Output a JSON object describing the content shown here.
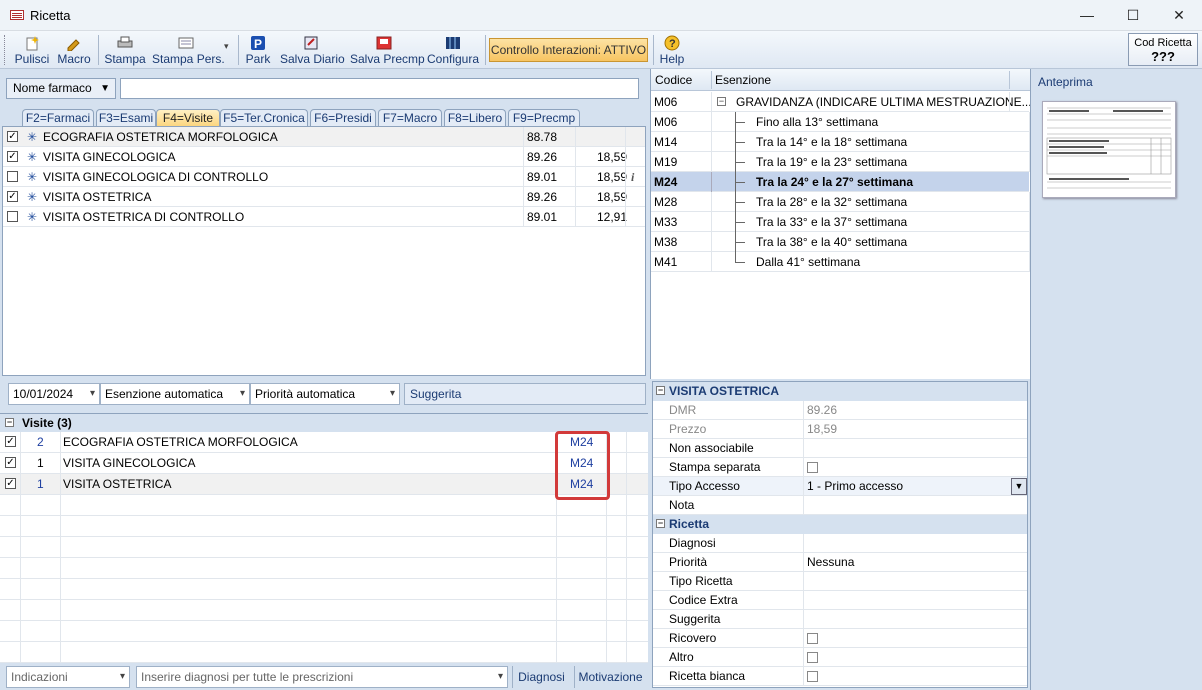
{
  "window": {
    "title": "Ricetta",
    "minimize": "—",
    "maximize": "☐",
    "close": "✕"
  },
  "toolbar": {
    "pulisci": "Pulisci",
    "macro": "Macro",
    "stampa": "Stampa",
    "stampa_pers": "Stampa Pers.",
    "park": "Park",
    "salva_diario": "Salva Diario",
    "salva_precmp": "Salva Precmp",
    "configura": "Configura",
    "controllo": "Controllo Interazioni: ATTIVO",
    "help": "Help",
    "cod_ricetta_label": "Cod Ricetta",
    "cod_ricetta_value": "???"
  },
  "search": {
    "mode": "Nome farmaco",
    "value": ""
  },
  "tabs": [
    "F2=Farmaci",
    "F3=Esami",
    "F4=Visite",
    "F5=Ter.Cronica",
    "F6=Presidi",
    "F7=Macro",
    "F8=Libero",
    "F9=Precmp"
  ],
  "active_tab": "F4=Visite",
  "catalog": [
    {
      "checked": true,
      "name": "ECOGRAFIA OSTETRICA MORFOLOGICA",
      "code": "88.78",
      "price": ""
    },
    {
      "checked": true,
      "name": "VISITA GINECOLOGICA",
      "code": "89.26",
      "price": "18,59"
    },
    {
      "checked": false,
      "name": "VISITA GINECOLOGICA DI CONTROLLO",
      "code": "89.01",
      "price": "18,59",
      "info": "i"
    },
    {
      "checked": true,
      "name": "VISITA OSTETRICA",
      "code": "89.26",
      "price": "18,59"
    },
    {
      "checked": false,
      "name": "VISITA OSTETRICA DI CONTROLLO",
      "code": "89.01",
      "price": "12,91"
    }
  ],
  "filters": {
    "date": "10/01/2024",
    "esenzione": "Esenzione automatica",
    "priorita": "Priorità automatica",
    "suggerita": "Suggerita"
  },
  "visits": {
    "header": "Visite (3)",
    "rows": [
      {
        "qty": "2",
        "name": "ECOGRAFIA OSTETRICA MORFOLOGICA",
        "code": "M24"
      },
      {
        "qty": "1",
        "name": "VISITA GINECOLOGICA",
        "code": "M24"
      },
      {
        "qty": "1",
        "name": "VISITA OSTETRICA",
        "code": "M24"
      }
    ]
  },
  "bottom": {
    "indicazioni": "Indicazioni",
    "diagnosi_placeholder": "Inserire diagnosi per tutte le prescrizioni",
    "diagnosi": "Diagnosi",
    "motivazione": "Motivazione"
  },
  "esenzioni": {
    "col_codice": "Codice",
    "col_esenzione": "Esenzione",
    "rows": [
      {
        "code": "M06",
        "desc": "GRAVIDANZA (INDICARE ULTIMA MESTRUAZIONE...",
        "parent": true
      },
      {
        "code": "M06",
        "desc": "Fino alla 13° settimana"
      },
      {
        "code": "M14",
        "desc": "Tra la 14° e la 18° settimana"
      },
      {
        "code": "M19",
        "desc": "Tra la 19° e la 23° settimana"
      },
      {
        "code": "M24",
        "desc": "Tra la 24° e la 27° settimana",
        "selected": true
      },
      {
        "code": "M28",
        "desc": "Tra la 28° e la 32° settimana"
      },
      {
        "code": "M33",
        "desc": "Tra la 33° e la 37° settimana"
      },
      {
        "code": "M38",
        "desc": "Tra la 38° e la 40° settimana"
      },
      {
        "code": "M41",
        "desc": "Dalla 41° settimana"
      }
    ]
  },
  "properties": {
    "section1": "VISITA OSTETRICA",
    "dmr_label": "DMR",
    "dmr": "89.26",
    "prezzo_label": "Prezzo",
    "prezzo": "18,59",
    "non_assoc": "Non associabile",
    "stampa_sep": "Stampa separata",
    "tipo_accesso_label": "Tipo Accesso",
    "tipo_accesso": "1 - Primo accesso",
    "nota": "Nota",
    "section2": "Ricetta",
    "diagnosi": "Diagnosi",
    "priorita_label": "Priorità",
    "priorita": "Nessuna",
    "tipo_ricetta": "Tipo Ricetta",
    "codice_extra": "Codice Extra",
    "suggerita": "Suggerita",
    "ricovero": "Ricovero",
    "altro": "Altro",
    "ricetta_bianca": "Ricetta bianca"
  },
  "preview": {
    "title": "Anteprima"
  }
}
